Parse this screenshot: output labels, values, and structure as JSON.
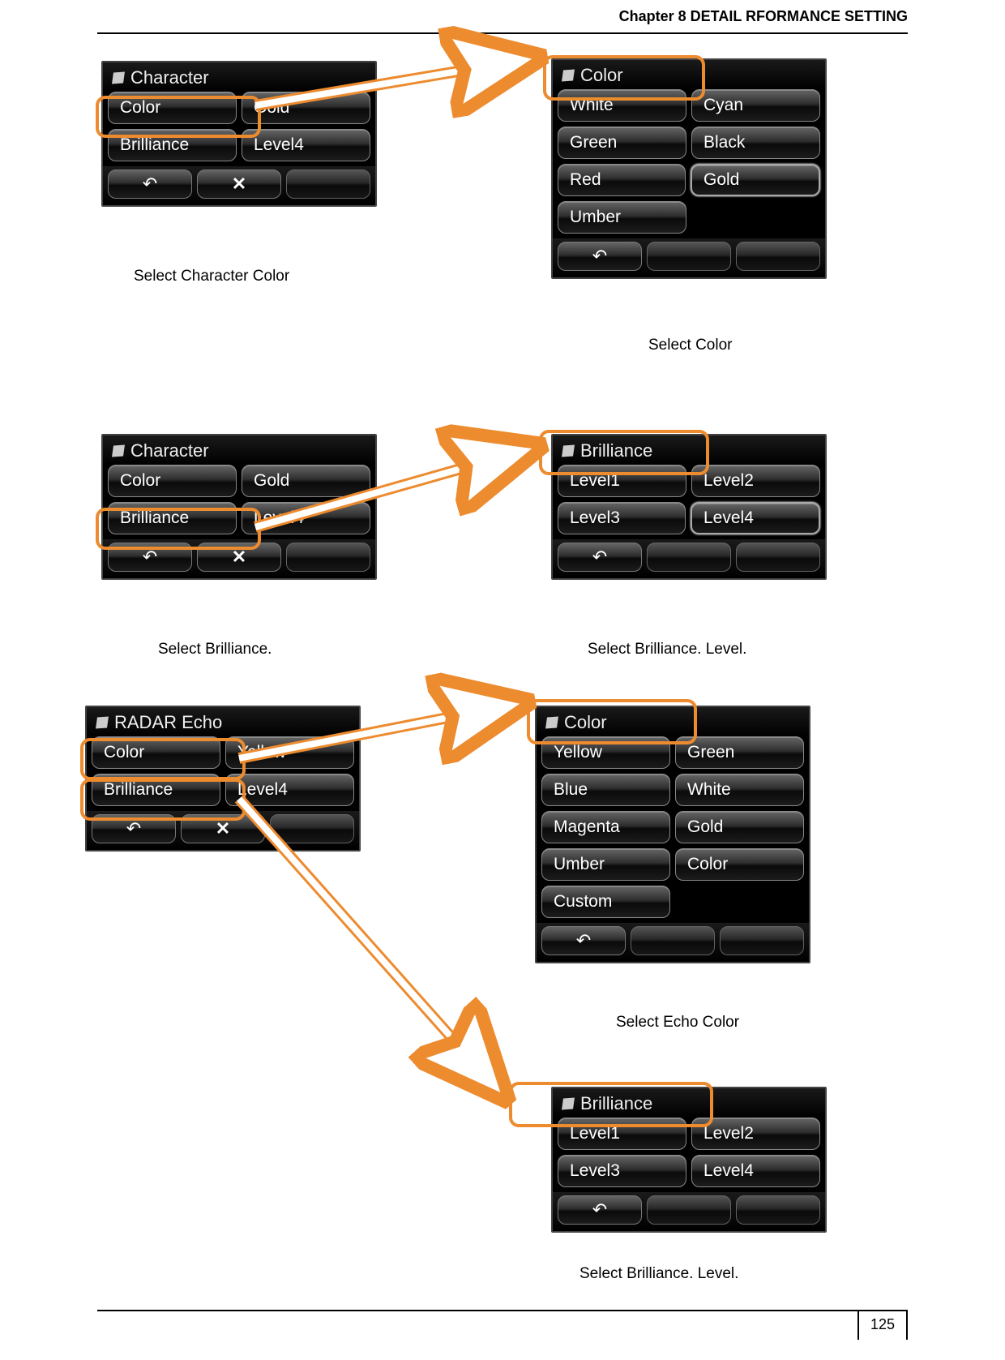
{
  "header": {
    "chapter": "Chapter 8    DETAIL RFORMANCE SETTING"
  },
  "footer": {
    "page_number": "125"
  },
  "panels": {
    "character1": {
      "title": "Character",
      "rows": [
        {
          "left": "Color",
          "right": "Gold"
        },
        {
          "left": "Brilliance",
          "right": "Level4"
        }
      ]
    },
    "color1": {
      "title": "Color",
      "rows": [
        {
          "left": "White",
          "right": "Cyan"
        },
        {
          "left": "Green",
          "right": "Black"
        },
        {
          "left": "Red",
          "right": "Gold"
        },
        {
          "left": "Umber",
          "right": ""
        }
      ],
      "selected": "Gold"
    },
    "character2": {
      "title": "Character",
      "rows": [
        {
          "left": "Color",
          "right": "Gold"
        },
        {
          "left": "Brilliance",
          "right": "Level4"
        }
      ]
    },
    "brilliance1": {
      "title": "Brilliance",
      "rows": [
        {
          "left": "Level1",
          "right": "Level2"
        },
        {
          "left": "Level3",
          "right": "Level4"
        }
      ],
      "selected": "Level4"
    },
    "radar_echo": {
      "title": "RADAR Echo",
      "rows": [
        {
          "left": "Color",
          "right": "Yellow"
        },
        {
          "left": "Brilliance",
          "right": "Level4"
        }
      ]
    },
    "color2": {
      "title": "Color",
      "rows": [
        {
          "left": "Yellow",
          "right": "Green"
        },
        {
          "left": "Blue",
          "right": "White"
        },
        {
          "left": "Magenta",
          "right": "Gold"
        },
        {
          "left": "Umber",
          "right": "Color"
        },
        {
          "left": "Custom",
          "right": ""
        }
      ]
    },
    "brilliance2": {
      "title": "Brilliance",
      "rows": [
        {
          "left": "Level1",
          "right": "Level2"
        },
        {
          "left": "Level3",
          "right": "Level4"
        }
      ]
    }
  },
  "captions": {
    "c1": "Select Character Color",
    "c2": "Select Color",
    "c3": "Select Brilliance.",
    "c4": "Select Brilliance. Level.",
    "c5": "Select Echo Color",
    "c6": "Select Brilliance. Level."
  }
}
